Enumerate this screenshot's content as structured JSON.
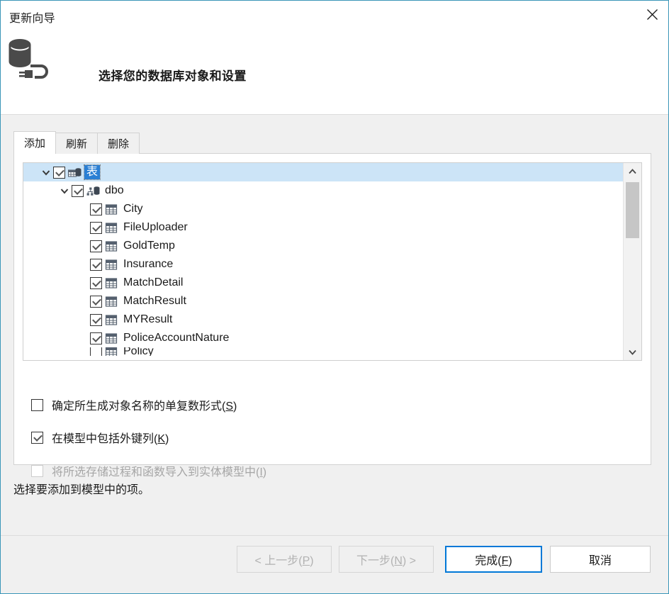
{
  "window": {
    "title": "更新向导",
    "close_icon": "close-icon",
    "border_color": "#3a96b8"
  },
  "header": {
    "icon": "database-connection-icon",
    "heading": "选择您的数据库对象和设置"
  },
  "tabs": [
    {
      "label": "添加",
      "active": true
    },
    {
      "label": "刷新",
      "active": false
    },
    {
      "label": "删除",
      "active": false
    }
  ],
  "tree": {
    "rows": [
      {
        "label": "表",
        "indent": 0,
        "expander": "chevron-down-icon",
        "checked": true,
        "icon": "tables-folder-icon",
        "selected": true,
        "highlight": true,
        "clipped": false
      },
      {
        "label": "dbo",
        "indent": 1,
        "expander": "chevron-down-icon",
        "checked": true,
        "icon": "schema-icon",
        "selected": false,
        "highlight": false,
        "clipped": false
      },
      {
        "label": "City",
        "indent": 2,
        "expander": "",
        "checked": true,
        "icon": "table-icon",
        "selected": false,
        "highlight": false,
        "clipped": false
      },
      {
        "label": "FileUploader",
        "indent": 2,
        "expander": "",
        "checked": true,
        "icon": "table-icon",
        "selected": false,
        "highlight": false,
        "clipped": false
      },
      {
        "label": "GoldTemp",
        "indent": 2,
        "expander": "",
        "checked": true,
        "icon": "table-icon",
        "selected": false,
        "highlight": false,
        "clipped": false
      },
      {
        "label": "Insurance",
        "indent": 2,
        "expander": "",
        "checked": true,
        "icon": "table-icon",
        "selected": false,
        "highlight": false,
        "clipped": false
      },
      {
        "label": "MatchDetail",
        "indent": 2,
        "expander": "",
        "checked": true,
        "icon": "table-icon",
        "selected": false,
        "highlight": false,
        "clipped": false
      },
      {
        "label": "MatchResult",
        "indent": 2,
        "expander": "",
        "checked": true,
        "icon": "table-icon",
        "selected": false,
        "highlight": false,
        "clipped": false
      },
      {
        "label": "MYResult",
        "indent": 2,
        "expander": "",
        "checked": true,
        "icon": "table-icon",
        "selected": false,
        "highlight": false,
        "clipped": false
      },
      {
        "label": "PoliceAccountNature",
        "indent": 2,
        "expander": "",
        "checked": true,
        "icon": "table-icon",
        "selected": false,
        "highlight": false,
        "clipped": false
      },
      {
        "label": "Policy",
        "indent": 2,
        "expander": "",
        "checked": false,
        "icon": "table-icon",
        "selected": false,
        "highlight": false,
        "clipped": true
      }
    ],
    "scrollbar": {
      "up_icon": "chevron-up-icon",
      "down_icon": "chevron-down-icon"
    }
  },
  "options": [
    {
      "name": "pluralize",
      "text_before": "确定所生成对象名称的单复数形式(",
      "accel": "S",
      "text_after": ")",
      "checked": false,
      "disabled": false
    },
    {
      "name": "foreign-keys",
      "text_before": "在模型中包括外键列(",
      "accel": "K",
      "text_after": ")",
      "checked": true,
      "disabled": false
    },
    {
      "name": "stored-procedures",
      "text_before": "将所选存储过程和函数导入到实体模型中(",
      "accel": "I",
      "text_after": ")",
      "checked": false,
      "disabled": true
    }
  ],
  "status": {
    "text": "选择要添加到模型中的项。"
  },
  "buttons": {
    "back": {
      "text_before": "< 上一步(",
      "accel": "P",
      "text_after": ")",
      "disabled": true,
      "default": false
    },
    "next": {
      "text_before": "下一步(",
      "accel": "N",
      "text_after": ") >",
      "disabled": true,
      "default": false
    },
    "finish": {
      "text_before": "完成(",
      "accel": "F",
      "text_after": ")",
      "disabled": false,
      "default": true
    },
    "cancel": {
      "text_before": "取消",
      "accel": "",
      "text_after": "",
      "disabled": false,
      "default": false
    }
  },
  "colors": {
    "accent": "#0078d7",
    "selection": "#2a7fd4",
    "frame": "#3a96b8",
    "panel": "#f0f0f0"
  }
}
